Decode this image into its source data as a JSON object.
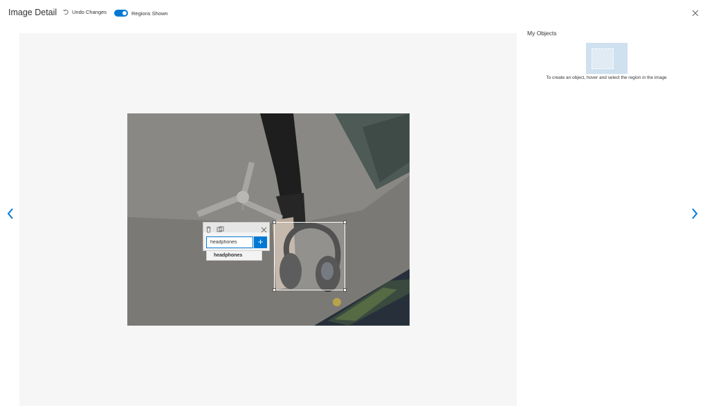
{
  "header": {
    "title": "Image Detail",
    "undo_label": "Undo Changes",
    "toggle_label": "Regions Shown",
    "toggle_on": true
  },
  "region_editor": {
    "tag_input_value": "headphones",
    "add_label": "+",
    "suggestion": "headphones"
  },
  "sidebar": {
    "title": "My Objects",
    "hint": "To create an object, hover and select the region in the image"
  },
  "colors": {
    "accent": "#0078d4",
    "canvas_bg": "#f6f6f6",
    "placeholder_bg": "#cfe0ef"
  },
  "icons": [
    "undo-icon",
    "close-icon",
    "chevron-left-icon",
    "chevron-right-icon",
    "trash-icon",
    "copy-tag-icon"
  ]
}
